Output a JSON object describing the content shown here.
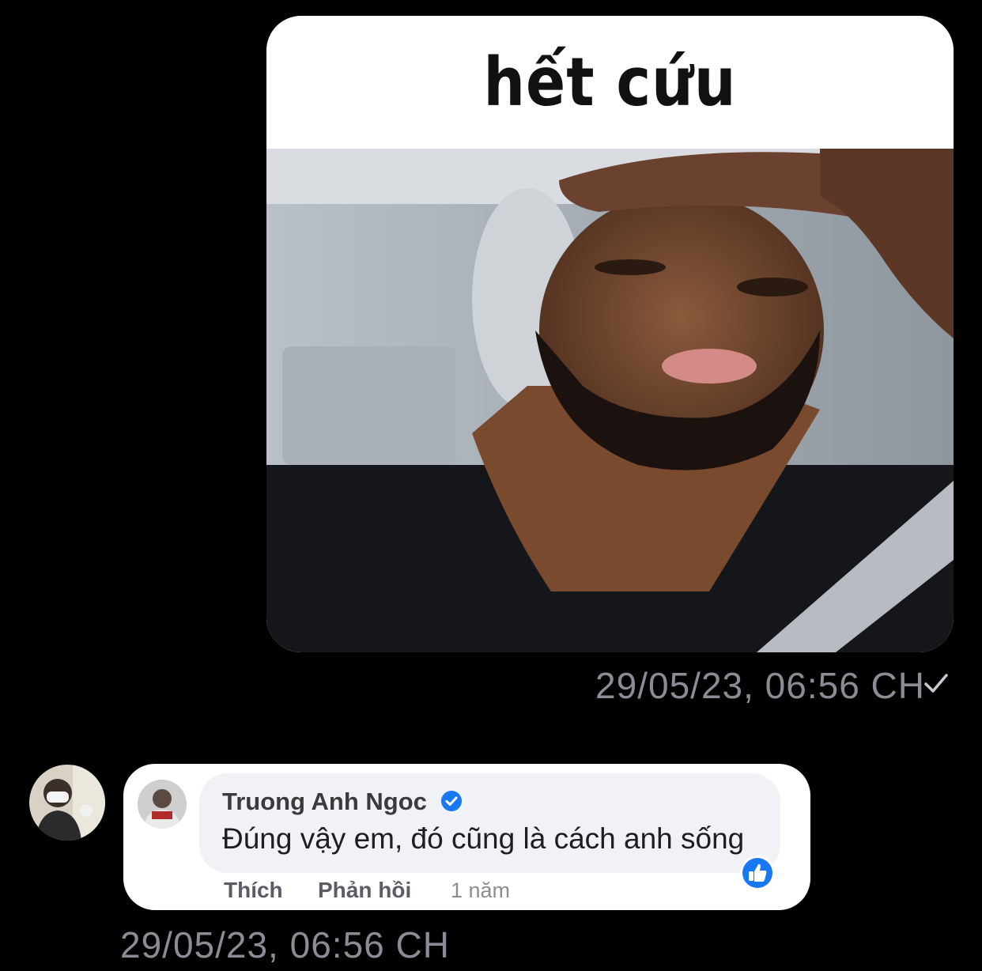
{
  "outgoing": {
    "meme_caption": "hết cứu",
    "timestamp": "29/05/23, 06:56 CH",
    "read_icon": "checkmark-icon"
  },
  "incoming": {
    "timestamp": "29/05/23, 06:56 CH",
    "comment": {
      "name": "Truong Anh Ngoc",
      "verified_icon": "verified-badge-icon",
      "text": "Đúng vậy em, đó cũng là cách anh sống",
      "like_label": "Thích",
      "reply_label": "Phản hồi",
      "age": "1 năm",
      "reaction_icon": "thumbs-up-icon"
    }
  },
  "colors": {
    "background": "#000000",
    "timestamp": "#8c8c96",
    "verified_blue": "#1877f2",
    "comment_bg": "#f0f2f5"
  }
}
